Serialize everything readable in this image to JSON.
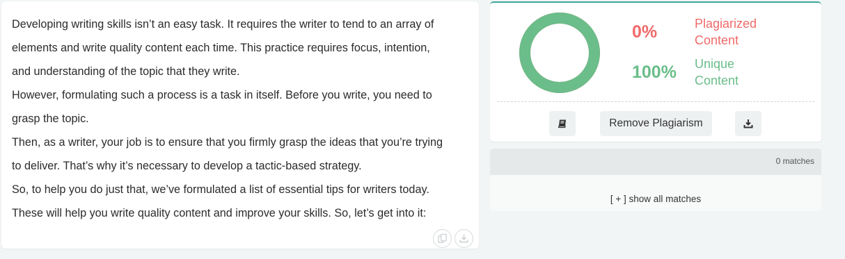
{
  "text": {
    "lines": [
      "Developing writing skills isn’t an easy task. It requires the writer to tend to an array of",
      "elements and write quality content each time. This practice requires focus, intention,",
      "and understanding of the topic that they write.",
      "However, formulating such a process is a task in itself. Before you write, you need to",
      "grasp the topic.",
      "Then, as a writer, your job is to ensure that you firmly grasp the ideas that you’re trying",
      "to deliver. That’s why it’s necessary to develop a tactic-based strategy.",
      "So, to help you do just that, we’ve formulated a list of essential tips for writers today.",
      "These will help you write quality content and improve your skills. So, let’s get into it:"
    ]
  },
  "card_actions": {
    "copy_icon": "copy-icon",
    "download_icon": "download-icon"
  },
  "result": {
    "plagiarized_percent": "0%",
    "plagiarized_label_1": "Plagiarized",
    "plagiarized_label_2": "Content",
    "unique_percent": "100%",
    "unique_label_1": "Unique",
    "unique_label_2": "Content",
    "unique_fraction": 1.0,
    "colors": {
      "plagiarized": "#f06a6a",
      "unique": "#6bbd8a",
      "accent": "#3aa699"
    },
    "book_icon": "book-icon",
    "remove_plagiarism_label": "Remove Plagiarism",
    "download_icon": "download-icon"
  },
  "matches": {
    "count_label": "0 matches",
    "show_all_label": "[ + ] show all matches"
  }
}
